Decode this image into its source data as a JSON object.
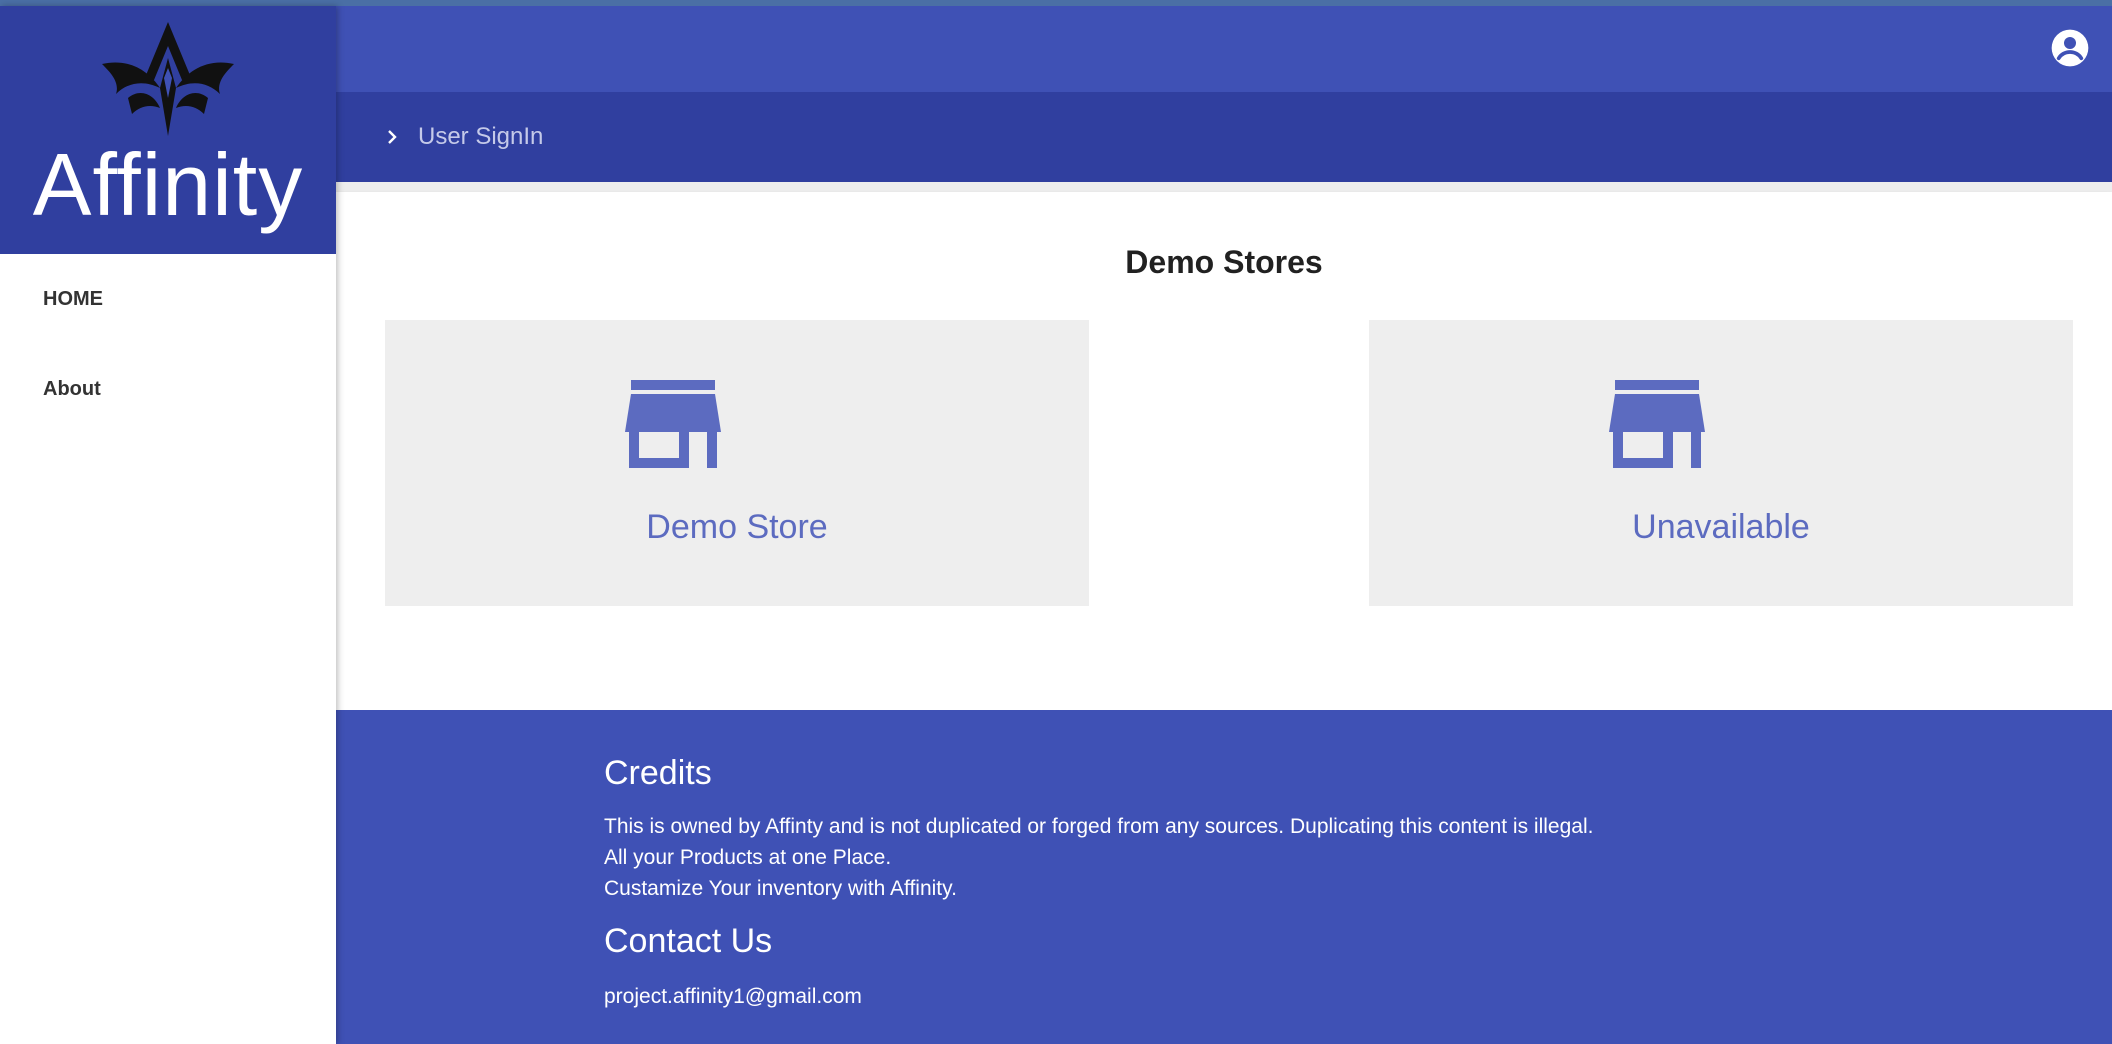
{
  "app": {
    "brand_name": "Affinity",
    "accent_color": "#3f51b5",
    "accent_dark": "#303f9f",
    "store_color": "#5c6bc0"
  },
  "sidebar": {
    "items": [
      {
        "label": "HOME"
      },
      {
        "label": "About"
      }
    ]
  },
  "topbar": {
    "user_icon": "account-circle-icon"
  },
  "breadcrumb": {
    "items": [
      {
        "label": "User SignIn"
      }
    ]
  },
  "main": {
    "title": "Demo Stores",
    "stores": [
      {
        "label": "Demo Store",
        "icon": "store-icon"
      },
      {
        "label": "Unavailable",
        "icon": "store-icon"
      }
    ]
  },
  "footer": {
    "credits_title": "Credits",
    "credits_lines": [
      "This is owned by Affinty and is not duplicated or forged from any sources. Duplicating this content is illegal.",
      "All your Products at one Place.",
      "Custamize Your inventory with Affinity."
    ],
    "contact_title": "Contact Us",
    "email": "project.affinity1@gmail.com"
  }
}
